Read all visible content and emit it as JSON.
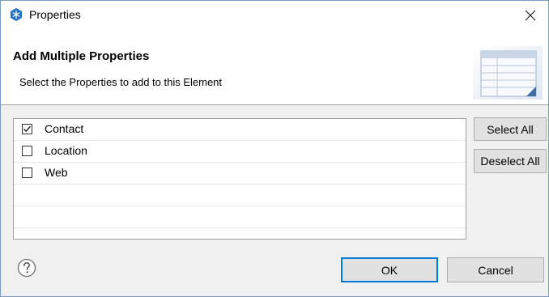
{
  "window": {
    "title": "Properties",
    "icon": "snowflake-app-icon",
    "close_icon": "close-icon"
  },
  "header": {
    "title": "Add Multiple Properties",
    "description": "Select the Properties to add to this Element",
    "graphic": "table-icon"
  },
  "properties": {
    "items": [
      {
        "label": "Contact",
        "checked": true
      },
      {
        "label": "Location",
        "checked": false
      },
      {
        "label": "Web",
        "checked": false
      }
    ]
  },
  "side_buttons": {
    "select_all": "Select All",
    "deselect_all": "Deselect All"
  },
  "footer": {
    "help_icon": "help-icon",
    "ok": "OK",
    "cancel": "Cancel"
  },
  "colors": {
    "accent": "#0078d7",
    "window_border": "#7a9cc8",
    "dialog_bg": "#f0f0f0"
  }
}
